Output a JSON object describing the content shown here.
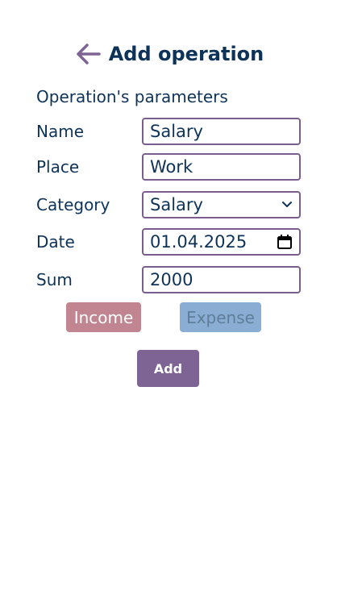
{
  "header": {
    "title": "Add operation",
    "back_icon": "arrow-left-icon",
    "back_icon_color": "#7e6494"
  },
  "form": {
    "section_label": "Operation's parameters",
    "fields": [
      {
        "label": "Name",
        "value": "Salary"
      },
      {
        "label": "Place",
        "value": "Work"
      },
      {
        "label": "Category",
        "value": "Salary",
        "icon": "chevron-down-icon"
      },
      {
        "label": "Date",
        "value": "01.04.2025",
        "icon": "calendar-icon"
      },
      {
        "label": "Sum",
        "value": "2000"
      }
    ]
  },
  "type_buttons": {
    "income_label": "Income",
    "expense_label": "Expense",
    "income_color": "#c08591",
    "expense_color": "#8aaed3"
  },
  "actions": {
    "add_label": "Add",
    "add_color": "#7e6494"
  },
  "colors": {
    "text": "#0e3358",
    "field_border": "#7a5e8f",
    "background": "#ffffff"
  }
}
